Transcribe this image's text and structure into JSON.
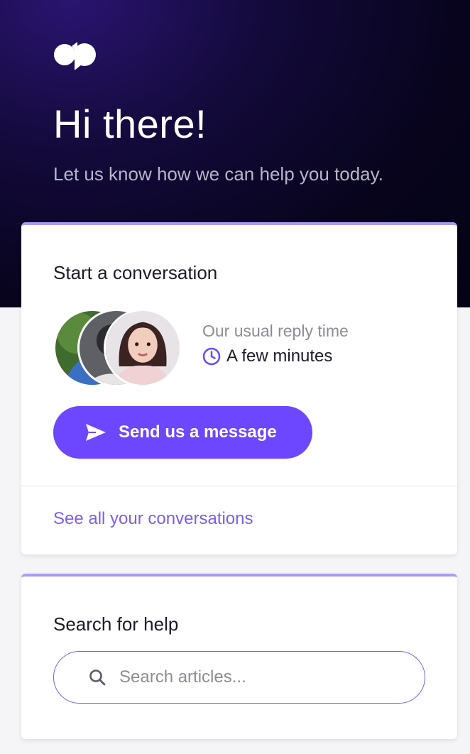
{
  "hero": {
    "logo_icon": "brand-logo-icon",
    "title": "Hi there!",
    "subtitle": "Let us know how we can help you today."
  },
  "conversation_card": {
    "title": "Start a conversation",
    "reply_label": "Our usual reply time",
    "reply_time": "A few minutes",
    "reply_icon": "clock-icon",
    "send_button_label": "Send us a message",
    "send_icon": "paper-plane-icon",
    "see_all_link": "See all your conversations",
    "avatar_count": 3
  },
  "search_card": {
    "title": "Search for help",
    "placeholder": "Search articles...",
    "value": "",
    "search_icon": "search-icon"
  },
  "colors": {
    "accent": "#6c47ff",
    "link": "#7b5cf5",
    "card_top_border": "#a99bf5",
    "hero_background": "#07041c"
  }
}
